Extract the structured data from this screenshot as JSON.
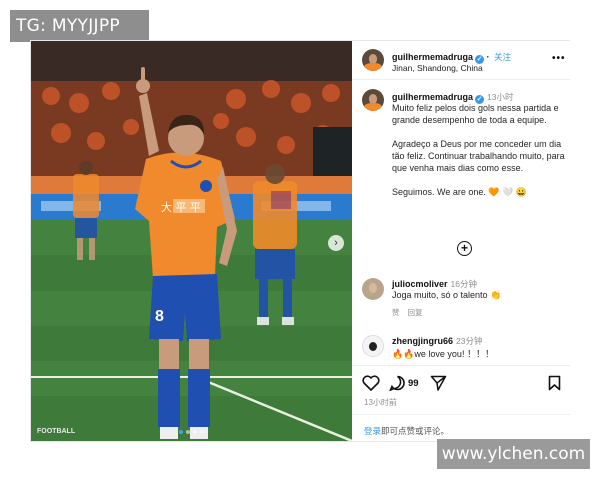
{
  "watermark": {
    "tag": "TG: MYYJJPP",
    "site": "www.ylchen.com"
  },
  "photo": {
    "credit": "FOOTBALL",
    "shirt_text": "大 平 平",
    "shirt_number": "8",
    "carousel_next": "›",
    "colors": {
      "kit": "#f08a2c",
      "shorts": "#1f4fb0",
      "pitch": "#3e7a3a"
    }
  },
  "header": {
    "username": "guilhermemadruga",
    "verified_mark": "✓",
    "follow_label": "关注",
    "location": "Jinan, Shandong, China",
    "more_icon": "•••"
  },
  "caption": {
    "username": "guilhermemadruga",
    "time": "13小时",
    "text": "Muito feliz pelos dois gols nessa partida e grande desempenho de toda a equipe.\n\nAgradeço a Deus por me conceder um dia tão feliz. Continuar trabalhando muito, para que venha mais dias como esse.\n\nSeguimos. We are one. 🧡 🤍 😀"
  },
  "add_comment_icon": "+",
  "comments": [
    {
      "username": "juliocmoliver",
      "time": "16分钟",
      "text": "Joga muito, só o talento 👏",
      "like_label": "赞",
      "reply_label": "回复"
    },
    {
      "username": "zhengjingru66",
      "time": "23分钟",
      "text": "🔥🔥we love you! ！！！"
    }
  ],
  "actions": {
    "likes_count": "99",
    "post_time": "13小时前"
  },
  "login_prompt": {
    "link": "登录",
    "text": "即可点赞或评论。"
  },
  "icons": {
    "like": "heart-icon",
    "comment": "comment-icon",
    "share": "share-icon",
    "save": "bookmark-icon",
    "more": "more-icon",
    "add": "add-circle-icon"
  }
}
